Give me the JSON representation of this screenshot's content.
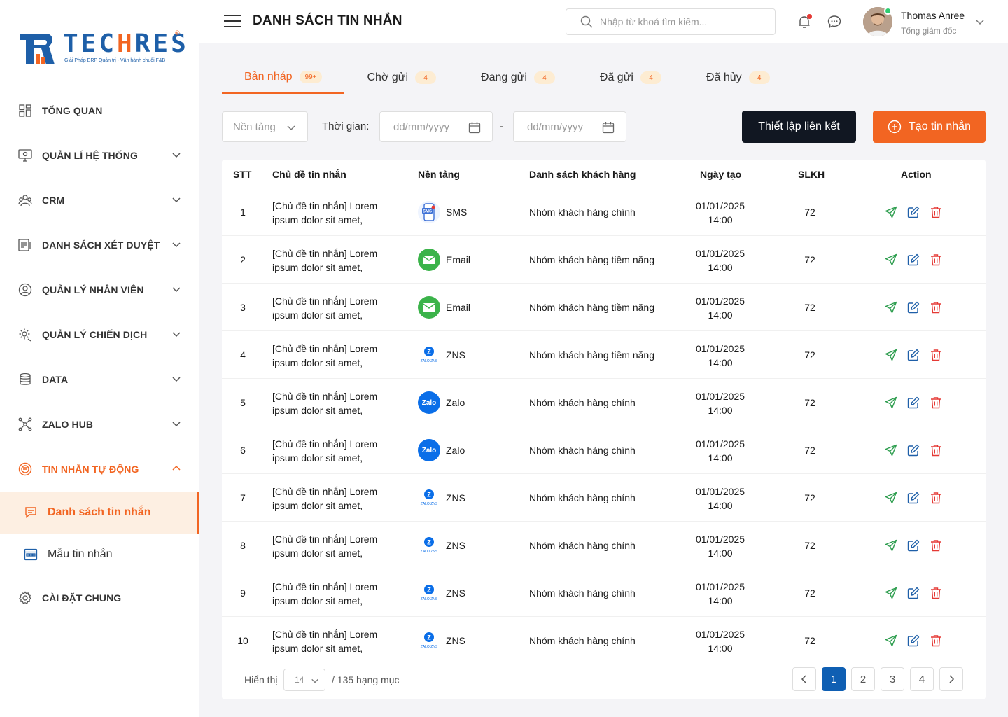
{
  "brand": {
    "name": "TECHRES",
    "tagline": "Giải Pháp ERP Quản trị - Vận hành chuỗi F&B"
  },
  "sidebar": {
    "items": [
      {
        "label": "TỔNG QUAN",
        "icon": "dashboard-icon"
      },
      {
        "label": "QUẢN LÍ HỆ THỐNG",
        "icon": "system-icon"
      },
      {
        "label": "CRM",
        "icon": "crm-icon"
      },
      {
        "label": "DANH SÁCH XÉT DUYỆT",
        "icon": "approval-icon"
      },
      {
        "label": "QUẢN LÝ NHÂN VIÊN",
        "icon": "employee-icon"
      },
      {
        "label": "QUẢN LÝ CHIẾN DỊCH",
        "icon": "campaign-icon"
      },
      {
        "label": "DATA",
        "icon": "database-icon"
      },
      {
        "label": "ZALO HUB",
        "icon": "hub-icon"
      },
      {
        "label": "TIN NHẮN TỰ ĐỘNG",
        "icon": "auto-message-icon"
      },
      {
        "label": "CÀI ĐẶT CHUNG",
        "icon": "settings-icon"
      }
    ],
    "sub_items": [
      {
        "label": "Danh sách tin nhắn",
        "icon": "message-list-icon"
      },
      {
        "label": "Mẫu tin nhắn",
        "icon": "template-icon"
      }
    ]
  },
  "header": {
    "title": "DANH SÁCH TIN NHẮN",
    "search_placeholder": "Nhập từ khoá tìm kiếm...",
    "user_name": "Thomas Anree",
    "user_role": "Tổng giám đốc"
  },
  "tabs": [
    {
      "label": "Bản nháp",
      "badge": "99+"
    },
    {
      "label": "Chờ gửi",
      "badge": "4"
    },
    {
      "label": "Đang gửi",
      "badge": "4"
    },
    {
      "label": "Đã gửi",
      "badge": "4"
    },
    {
      "label": "Đã hủy",
      "badge": "4"
    }
  ],
  "filters": {
    "platform_placeholder": "Nền tảng",
    "time_label": "Thời gian:",
    "date_from_placeholder": "dd/mm/yyyy",
    "date_separator": "-",
    "date_to_placeholder": "dd/mm/yyyy",
    "link_button": "Thiết lập liên kết",
    "create_button": "Tạo tin nhắn"
  },
  "table": {
    "headers": {
      "stt": "STT",
      "subject": "Chủ đề tin nhắn",
      "platform": "Nền tảng",
      "customer_list": "Danh sách khách hàng",
      "created": "Ngày tạo",
      "slkh": "SLKH",
      "action": "Action"
    },
    "rows": [
      {
        "stt": "1",
        "subject_1": "[Chủ đề tin nhắn] Lorem",
        "subject_2": "ipsum dolor sit amet,",
        "platform": "SMS",
        "customer_list": "Nhóm khách hàng chính",
        "date": "01/01/2025",
        "time": "14:00",
        "slkh": "72"
      },
      {
        "stt": "2",
        "subject_1": "[Chủ đề tin nhắn] Lorem",
        "subject_2": "ipsum dolor sit amet,",
        "platform": "Email",
        "customer_list": "Nhóm khách hàng tiềm năng",
        "date": "01/01/2025",
        "time": "14:00",
        "slkh": "72"
      },
      {
        "stt": "3",
        "subject_1": "[Chủ đề tin nhắn] Lorem",
        "subject_2": "ipsum dolor sit amet,",
        "platform": "Email",
        "customer_list": "Nhóm khách hàng tiềm năng",
        "date": "01/01/2025",
        "time": "14:00",
        "slkh": "72"
      },
      {
        "stt": "4",
        "subject_1": "[Chủ đề tin nhắn] Lorem",
        "subject_2": "ipsum dolor sit amet,",
        "platform": "ZNS",
        "customer_list": "Nhóm khách hàng tiềm năng",
        "date": "01/01/2025",
        "time": "14:00",
        "slkh": "72"
      },
      {
        "stt": "5",
        "subject_1": "[Chủ đề tin nhắn] Lorem",
        "subject_2": "ipsum dolor sit amet,",
        "platform": "Zalo",
        "customer_list": "Nhóm khách hàng chính",
        "date": "01/01/2025",
        "time": "14:00",
        "slkh": "72"
      },
      {
        "stt": "6",
        "subject_1": "[Chủ đề tin nhắn] Lorem",
        "subject_2": "ipsum dolor sit amet,",
        "platform": "Zalo",
        "customer_list": "Nhóm khách hàng chính",
        "date": "01/01/2025",
        "time": "14:00",
        "slkh": "72"
      },
      {
        "stt": "7",
        "subject_1": "[Chủ đề tin nhắn] Lorem",
        "subject_2": "ipsum dolor sit amet,",
        "platform": "ZNS",
        "customer_list": "Nhóm khách hàng chính",
        "date": "01/01/2025",
        "time": "14:00",
        "slkh": "72"
      },
      {
        "stt": "8",
        "subject_1": "[Chủ đề tin nhắn] Lorem",
        "subject_2": "ipsum dolor sit amet,",
        "platform": "ZNS",
        "customer_list": "Nhóm khách hàng chính",
        "date": "01/01/2025",
        "time": "14:00",
        "slkh": "72"
      },
      {
        "stt": "9",
        "subject_1": "[Chủ đề tin nhắn] Lorem",
        "subject_2": "ipsum dolor sit amet,",
        "platform": "ZNS",
        "customer_list": "Nhóm khách hàng chính",
        "date": "01/01/2025",
        "time": "14:00",
        "slkh": "72"
      },
      {
        "stt": "10",
        "subject_1": "[Chủ đề tin nhắn] Lorem",
        "subject_2": "ipsum dolor sit amet,",
        "platform": "ZNS",
        "customer_list": "Nhóm khách hàng chính",
        "date": "01/01/2025",
        "time": "14:00",
        "slkh": "72"
      }
    ]
  },
  "pagination": {
    "show_label": "Hiển thị",
    "page_size": "14",
    "total_label": "/ 135 hạng mục",
    "pages": [
      "1",
      "2",
      "3",
      "4"
    ],
    "current": "1"
  },
  "colors": {
    "accent": "#f26522",
    "brand_blue": "#1e5fa8",
    "dark_button": "#111722",
    "active_page": "#0f5fb3",
    "send": "#2e9e4f",
    "edit": "#1e5fa8",
    "delete": "#e53935"
  }
}
